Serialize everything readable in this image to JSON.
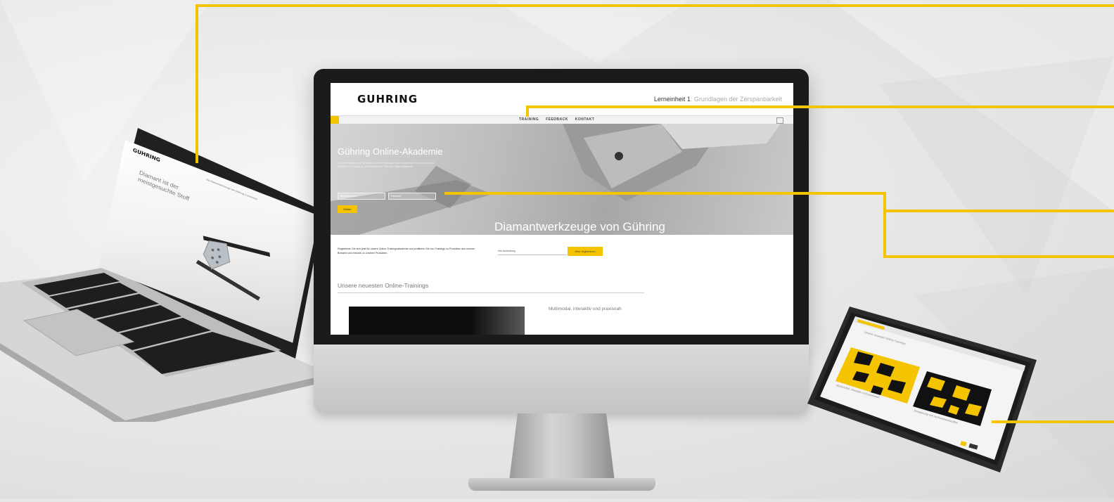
{
  "colors": {
    "accent": "#f5c400",
    "dark": "#1b1b1b",
    "light_bg": "#e9e9e9"
  },
  "desktop": {
    "brand": "GUHRING",
    "lesson": {
      "label": "Lerneinheit 1",
      "subtitle": ": Grundlagen der Zerspanbarkeit"
    },
    "nav": {
      "items": [
        "TRAINING",
        "FEEDBACK",
        "KONTAKT"
      ]
    },
    "hero": {
      "title": "Gühring Online-Akademie",
      "text": "Sie interessieren sich für unsere Online-Trainings? Dann registrieren Sie sich jetzt und erhalten Sie Zugang zu allen Kursen der Gühring Online-Akademie.",
      "username_placeholder": "Benutzername",
      "password_placeholder": "Passwort",
      "login_label": "Weiter",
      "caption": "Diamantwerkzeuge von Gühring"
    },
    "register": {
      "text": "Registrieren Sie sich jetzt für unsere Online-Trainingsakademie und profitieren Sie von Trainings zu Produkten aus unserer Branche und exklusiv zu unseren Produkten.",
      "input_value": "Ihre Anmeldung",
      "button_label": "Jetzt registrieren"
    },
    "newest": {
      "heading": "Unsere neuesten Online-Trainings",
      "teaser": "Multimodal, interaktiv und praxisnah"
    }
  },
  "laptop": {
    "brand": "GUHRING",
    "header_text": "Die Diamantwerkzeuge von Gühring | Lerneinheit",
    "hero_line1": "Diamant ist der",
    "hero_line2": "meistgesuchte Stoff"
  },
  "tablet": {
    "heading": "Unsere neuesten Online-Trainings",
    "caption1": "Multimodal, interaktiv und praxisnah",
    "caption2": "Zerspanung von Verbundwerkstoffen"
  }
}
